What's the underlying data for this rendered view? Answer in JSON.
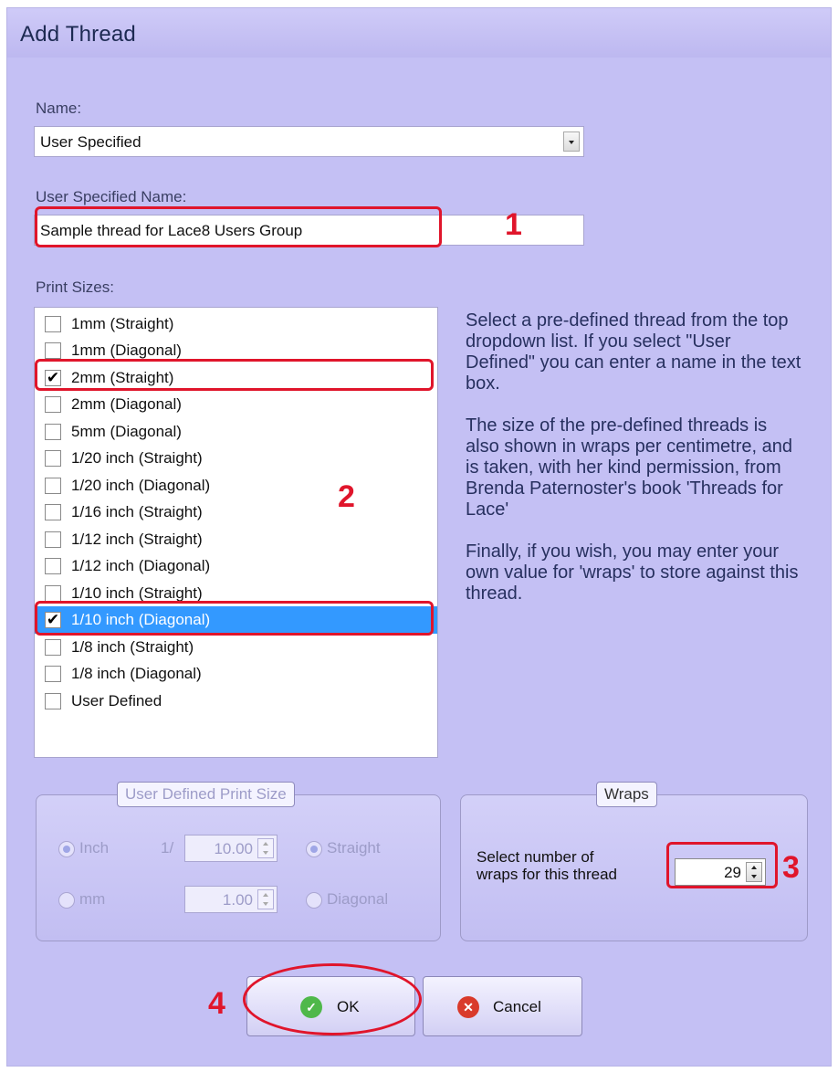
{
  "window": {
    "title": "Add Thread"
  },
  "name_section": {
    "label": "Name:",
    "selected": "User Specified"
  },
  "user_name_section": {
    "label": "User Specified Name:",
    "value": "Sample thread for Lace8 Users Group"
  },
  "print_sizes": {
    "label": "Print Sizes:",
    "items": [
      {
        "label": "1mm (Straight)",
        "checked": false
      },
      {
        "label": "1mm (Diagonal)",
        "checked": false
      },
      {
        "label": "2mm (Straight)",
        "checked": true
      },
      {
        "label": "2mm (Diagonal)",
        "checked": false
      },
      {
        "label": "5mm (Diagonal)",
        "checked": false
      },
      {
        "label": "1/20 inch (Straight)",
        "checked": false
      },
      {
        "label": "1/20 inch (Diagonal)",
        "checked": false
      },
      {
        "label": "1/16 inch (Straight)",
        "checked": false
      },
      {
        "label": "1/12 inch (Straight)",
        "checked": false
      },
      {
        "label": "1/12 inch (Diagonal)",
        "checked": false
      },
      {
        "label": "1/10 inch (Straight)",
        "checked": false
      },
      {
        "label": "1/10 inch (Diagonal)",
        "checked": true,
        "selected": true
      },
      {
        "label": "1/8 inch (Straight)",
        "checked": false
      },
      {
        "label": "1/8 inch (Diagonal)",
        "checked": false
      },
      {
        "label": "User Defined",
        "checked": false
      }
    ]
  },
  "help": {
    "p1": "Select a pre-defined thread from the top dropdown list. If you select \"User Defined\" you can enter a name in the text box.",
    "p2": "The size of the pre-defined threads is also shown in wraps per centimetre, and is taken, with her kind permission, from Brenda Paternoster's book 'Threads for Lace'",
    "p3": "Finally, if you wish, you may enter your own value for 'wraps' to store against this thread."
  },
  "user_defined_print_size": {
    "legend": "User Defined Print Size",
    "inch_label": "Inch",
    "mm_label": "mm",
    "fraction_prefix": "1/",
    "inch_value": "10.00",
    "mm_value": "1.00",
    "straight_label": "Straight",
    "diagonal_label": "Diagonal"
  },
  "wraps": {
    "legend": "Wraps",
    "label_line1": "Select number of",
    "label_line2": "wraps for this thread",
    "value": "29"
  },
  "buttons": {
    "ok": "OK",
    "cancel": "Cancel"
  },
  "annotations": {
    "a1": "1",
    "a2": "2",
    "a3": "3",
    "a4": "4"
  },
  "colors": {
    "annotation": "#e0152b",
    "window_bg": "#c4c0f4",
    "selection": "#3399ff"
  }
}
